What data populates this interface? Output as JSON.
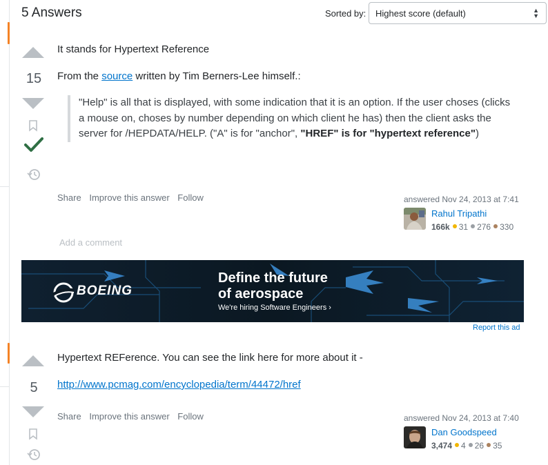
{
  "header": {
    "answers_count_label": "5 Answers",
    "sorted_by_label": "Sorted by:",
    "sort_selected": "Highest score (default)"
  },
  "answers": [
    {
      "score": "15",
      "line1": "It stands for Hypertext Reference",
      "line2_prefix": "From the ",
      "line2_link": "source",
      "line2_suffix": " written by Tim Berners-Lee himself.:",
      "quote_plain": "\"Help\" is all that is displayed, with some indication that it is an option. If the user choses (clicks a mouse on, choses by number depending on which client he has) then the client asks the server for /HEPDATA/HELP. (\"A\" is for \"anchor\", ",
      "quote_bold": "\"HREF\" is for \"hypertext reference\"",
      "quote_end": ")",
      "menu": [
        "Share",
        "Improve this answer",
        "Follow"
      ],
      "answered": "answered Nov 24, 2013 at 7:41",
      "user_name": "Rahul Tripathi",
      "reputation": "166k",
      "gold": "31",
      "silver": "276",
      "bronze": "330",
      "add_comment": "Add a comment"
    },
    {
      "score": "5",
      "line1": "Hypertext REFerence. You can see the link here for more about it -",
      "link": "http://www.pcmag.com/encyclopedia/term/44472/href",
      "menu": [
        "Share",
        "Improve this answer",
        "Follow"
      ],
      "answered": "answered Nov 24, 2013 at 7:40",
      "user_name": "Dan Goodspeed",
      "reputation": "3,474",
      "gold": "4",
      "silver": "26",
      "bronze": "35"
    }
  ],
  "ad": {
    "brand": "BOEING",
    "headline1": "Define the future",
    "headline2": "of aerospace",
    "sub": "We're hiring Software Engineers",
    "report": "Report this ad"
  },
  "colors": {
    "accent_link": "#0074cc",
    "accepted": "#2f6f44",
    "gold": "#f1b600",
    "silver": "#9a9fa4",
    "bronze": "#ab825f",
    "left_marker": "#f48225"
  },
  "icons": [
    "up-arrow-icon",
    "down-arrow-icon",
    "bookmark-icon",
    "accepted-check-icon",
    "history-icon",
    "chevron-right-icon"
  ]
}
